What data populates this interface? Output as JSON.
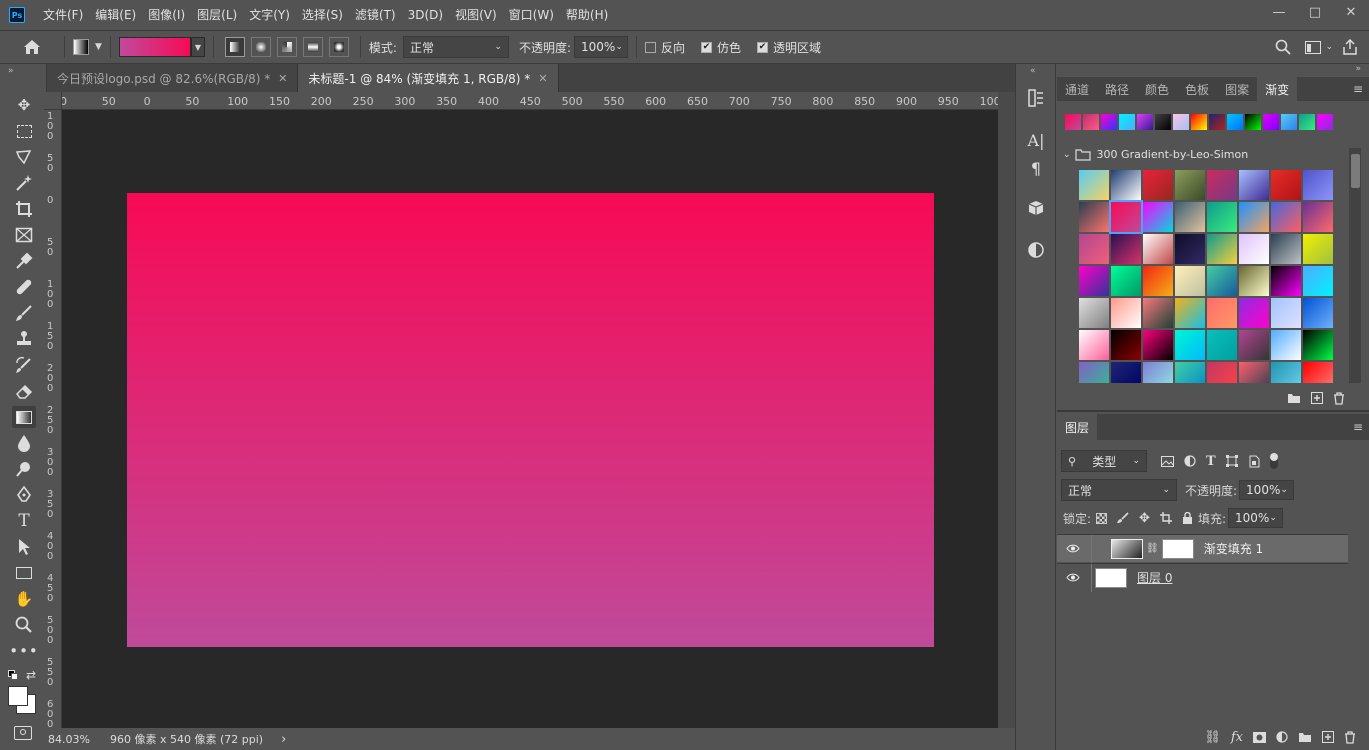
{
  "app": {
    "logo": "Ps"
  },
  "menu": [
    "文件(F)",
    "编辑(E)",
    "图像(I)",
    "图层(L)",
    "文字(Y)",
    "选择(S)",
    "滤镜(T)",
    "3D(D)",
    "视图(V)",
    "窗口(W)",
    "帮助(H)"
  ],
  "window_controls": {
    "minimize": "—",
    "restore": "□",
    "close": "✕"
  },
  "options": {
    "mode_label": "模式:",
    "mode_value": "正常",
    "opacity_label": "不透明度:",
    "opacity_value": "100%",
    "reverse_label": "反向",
    "reverse_checked": false,
    "dither_label": "仿色",
    "dither_checked": true,
    "transparency_label": "透明区域",
    "transparency_checked": true,
    "gradient_colors": [
      "#c04a9a",
      "#f70a55"
    ]
  },
  "tabs": [
    {
      "label": "今日预设logo.psd @ 82.6%(RGB/8) *",
      "active": false
    },
    {
      "label": "未标题-1 @ 84% (渐变填充 1, RGB/8) *",
      "active": true
    }
  ],
  "ruler_h": [
    "0",
    "50",
    "0",
    "50",
    "100",
    "150",
    "200",
    "250",
    "300",
    "350",
    "400",
    "450",
    "500",
    "550",
    "600",
    "650",
    "700",
    "750",
    "800",
    "850",
    "900",
    "950",
    "1000"
  ],
  "ruler_v": [
    "100",
    "50",
    "0",
    "50",
    "100",
    "150",
    "200",
    "250",
    "300",
    "350",
    "400",
    "450",
    "500",
    "550",
    "600"
  ],
  "canvas": {
    "gradient_top": "#f70a55",
    "gradient_bottom": "#c04a9a"
  },
  "status": {
    "zoom": "84.03%",
    "doc_info": "960 像素 x 540 像素 (72 ppi)",
    "arrow": "›"
  },
  "gradients_panel": {
    "tabs": [
      "通道",
      "路径",
      "颜色",
      "色板",
      "图案",
      "渐变"
    ],
    "active_tab": "渐变",
    "folder_name": "300 Gradient-by-Leo-Simon",
    "recent": [
      [
        "#f70a55",
        "#c04a9a"
      ],
      [
        "#c0306a",
        "#ff5a8a"
      ],
      [
        "#ff00cc",
        "#3333ff"
      ],
      [
        "#00f2fe",
        "#4facfe"
      ],
      [
        "#e040fb",
        "#311b92"
      ],
      [
        "#434343",
        "#000000"
      ],
      [
        "#fbc2eb",
        "#a6c1ee"
      ],
      [
        "#ff0000",
        "#ffff00"
      ],
      [
        "#1a2a6c",
        "#b21f1f"
      ],
      [
        "#00c6ff",
        "#0072ff"
      ],
      [
        "#000000",
        "#00ff00"
      ],
      [
        "#e100ff",
        "#7f00ff"
      ],
      [
        "#56ccf2",
        "#2f80ed"
      ],
      [
        "#11998e",
        "#38ef7d"
      ],
      [
        "#ff00ff",
        "#8a2be2"
      ]
    ],
    "swatches": [
      [
        "#56ccf2",
        "#f6d365"
      ],
      [
        "#1e3c72",
        "#ffffff"
      ],
      [
        "#ed213a",
        "#93291e"
      ],
      [
        "#8e9e5b",
        "#3a4a2a"
      ],
      [
        "#cc2b5e",
        "#753a88"
      ],
      [
        "#a8c0ff",
        "#3f2b96"
      ],
      [
        "#e52d27",
        "#b31217"
      ],
      [
        "#4e54c8",
        "#8f94fb"
      ],
      [
        "#2c3e50",
        "#fd746c"
      ],
      [
        "#f70a55",
        "#c04a9a"
      ],
      [
        "#fc00ff",
        "#00dbde"
      ],
      [
        "#3a6073",
        "#e0c3a0"
      ],
      [
        "#11998e",
        "#38ef7d"
      ],
      [
        "#1e90ff",
        "#f4a460"
      ],
      [
        "#4568dc",
        "#ff5e62"
      ],
      [
        "#6a3093",
        "#ff6b6b"
      ],
      [
        "#b24592",
        "#f15f79"
      ],
      [
        "#2b1055",
        "#d53369"
      ],
      [
        "#ffffff",
        "#c04848"
      ],
      [
        "#0f0c29",
        "#302b63"
      ],
      [
        "#11998e",
        "#f4d03f"
      ],
      [
        "#e0c3fc",
        "#ffffff"
      ],
      [
        "#2c3e50",
        "#bdc3c7"
      ],
      [
        "#f0f000",
        "#a0c040"
      ],
      [
        "#ff00cc",
        "#333399"
      ],
      [
        "#00ff99",
        "#009966"
      ],
      [
        "#f12711",
        "#f5af19"
      ],
      [
        "#ffefba",
        "#c0c0a0"
      ],
      [
        "#43cea2",
        "#185a9d"
      ],
      [
        "#666633",
        "#ffffcc"
      ],
      [
        "#000000",
        "#ff00ff"
      ],
      [
        "#4facfe",
        "#00f2fe"
      ],
      [
        "#e0e0e0",
        "#808080"
      ],
      [
        "#ff9a8b",
        "#ffffff"
      ],
      [
        "#f7797d",
        "#1f4037"
      ],
      [
        "#f5af19",
        "#12c2e9"
      ],
      [
        "#ff6b6b",
        "#ff9966"
      ],
      [
        "#8e2de2",
        "#ff00cc"
      ],
      [
        "#a1c4fd",
        "#e0e0ff"
      ],
      [
        "#0052d4",
        "#6fb1fc"
      ],
      [
        "#ffffff",
        "#ff5e9a"
      ],
      [
        "#000000",
        "#8b0000"
      ],
      [
        "#ff0080",
        "#000000"
      ],
      [
        "#00f5d4",
        "#00bbf9"
      ],
      [
        "#0abfbc",
        "#00a0a0"
      ],
      [
        "#b24592",
        "#353535"
      ],
      [
        "#4facfe",
        "#ffffff"
      ],
      [
        "#000000",
        "#00ff44"
      ],
      [
        "#8360c3",
        "#2ebf91"
      ],
      [
        "#1d2671",
        "#000066"
      ],
      [
        "#7f7fd5",
        "#91eae4"
      ],
      [
        "#43cea2",
        "#0088cc"
      ],
      [
        "#c33764",
        "#ff4444"
      ],
      [
        "#ff5f6d",
        "#2c3e50"
      ],
      [
        "#2193b0",
        "#6dd5ed"
      ],
      [
        "#ff0000",
        "#ff8080"
      ]
    ]
  },
  "layers_panel": {
    "tab": "图层",
    "filter_label": "类型",
    "blend_mode": "正常",
    "opacity_label": "不透明度:",
    "opacity_value": "100%",
    "lock_label": "锁定:",
    "fill_label": "填充:",
    "fill_value": "100%",
    "layers": [
      {
        "name": "渐变填充 1",
        "selected": true,
        "type": "gradient-fill"
      },
      {
        "name": "图层 0",
        "selected": false,
        "type": "pixel"
      }
    ]
  },
  "icons": {
    "home": "home-icon",
    "search": "search-icon",
    "workspace": "workspace-icon",
    "share": "share-icon"
  }
}
